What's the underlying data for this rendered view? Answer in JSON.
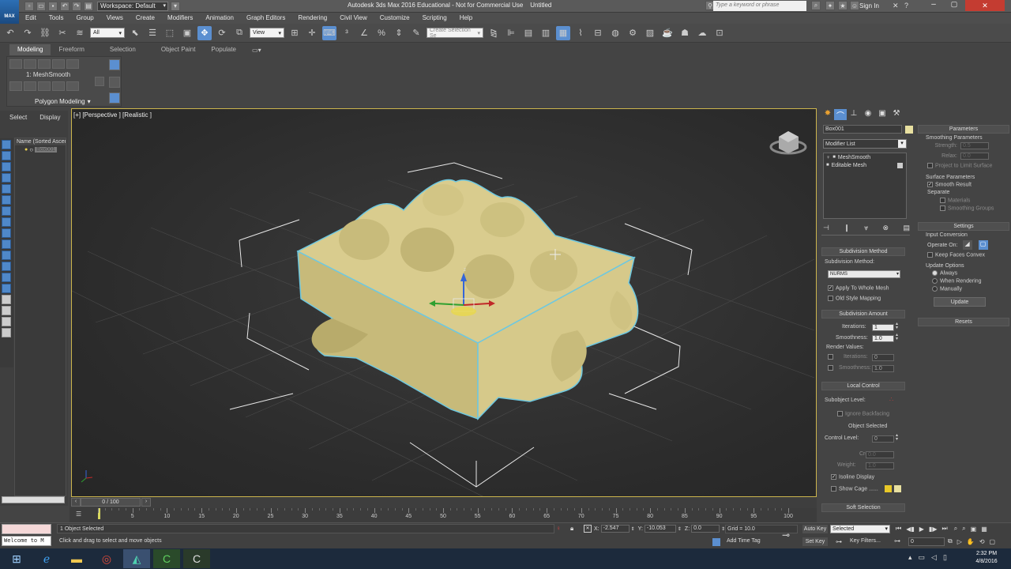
{
  "title_bar": {
    "app_icon_label": "MAX",
    "workspace": "Workspace: Default",
    "title": "Autodesk 3ds Max 2016 Educational - Not for Commercial Use    Untitled",
    "search_placeholder": "Type a keyword or phrase",
    "sign_in": "Sign In"
  },
  "menu": [
    "Edit",
    "Tools",
    "Group",
    "Views",
    "Create",
    "Modifiers",
    "Animation",
    "Graph Editors",
    "Rendering",
    "Civil View",
    "Customize",
    "Scripting",
    "Help"
  ],
  "main_toolbar": {
    "selection_filter": "All",
    "ref_coord": "View",
    "named_selection": "Create Selection Se"
  },
  "ribbon": {
    "tabs": [
      "Modeling",
      "Freeform",
      "Selection",
      "Object Paint",
      "Populate"
    ],
    "modifier_label": "1: MeshSmooth",
    "panel_label": "Polygon Modeling"
  },
  "scene_explorer": {
    "tabs": [
      "Select",
      "Display"
    ],
    "column_header": "Name (Sorted Ascen",
    "object": "Box001"
  },
  "viewport": {
    "label": "[+] [Perspective ] [Realistic ]",
    "gizmo_axis": "z"
  },
  "command_panel": {
    "object_name": "Box001",
    "object_color": "#e8e0a0",
    "modifier_list": "Modifier List",
    "stack": [
      "MeshSmooth",
      "Editable Mesh"
    ],
    "subdivision_method": {
      "header": "Subdivision Method",
      "label": "Subdivision Method:",
      "value": "NURMS",
      "apply_whole": "Apply To Whole Mesh",
      "old_style": "Old Style Mapping"
    },
    "subdivision_amount": {
      "header": "Subdivision Amount",
      "iterations_label": "Iterations:",
      "iterations": "1",
      "smoothness_label": "Smoothness:",
      "smoothness": "1.0",
      "render_values": "Render Values:",
      "r_iterations_label": "Iterations:",
      "r_iterations": "0",
      "r_smoothness_label": "Smoothness:",
      "r_smoothness": "1.0"
    },
    "local_control": {
      "header": "Local Control",
      "subobject": "Subobject Level:",
      "ignore_backfacing": "Ignore Backfacing",
      "object_selected": "Object Selected",
      "control_level_label": "Control Level:",
      "control_level": "0",
      "crease_label": "Crease:",
      "crease": "0.0",
      "weight_label": "Weight:",
      "weight": "1.0",
      "isoline": "Isoline Display",
      "show_cage": "Show Cage ......"
    },
    "soft_selection": "Soft Selection"
  },
  "right_rollout": {
    "parameters": "Parameters",
    "smoothing_params": "Smoothing Parameters",
    "strength_label": "Strength:",
    "strength": "0.5",
    "relax_label": "Relax:",
    "relax": "0.0",
    "project_limit": "Project to Limit Surface",
    "surface_params": "Surface Parameters",
    "smooth_result": "Smooth Result",
    "separate": "Separate",
    "materials": "Materials",
    "smoothing_groups": "Smoothing Groups",
    "settings": "Settings",
    "input_conversion": "Input Conversion",
    "operate_on": "Operate On:",
    "keep_faces_convex": "Keep Faces Convex",
    "update_options": "Update Options",
    "always": "Always",
    "when_rendering": "When Rendering",
    "manually": "Manually",
    "update": "Update",
    "resets": "Resets"
  },
  "timeline": {
    "frame_label": "0 / 100",
    "ticks": [
      "0",
      "5",
      "10",
      "15",
      "20",
      "25",
      "30",
      "35",
      "40",
      "45",
      "50",
      "55",
      "60",
      "65",
      "70",
      "75",
      "80",
      "85",
      "90",
      "95",
      "100"
    ]
  },
  "status": {
    "listener": "Welcome to M",
    "selected": "1 Object Selected",
    "prompt": "Click and drag to select and move objects",
    "x_label": "X:",
    "x": "-2.547",
    "y_label": "Y:",
    "y": "-10.053",
    "z_label": "Z:",
    "z": "0.0",
    "grid": "Grid = 10.0",
    "add_time_tag": "Add Time Tag",
    "auto_key": "Auto Key",
    "set_key": "Set Key",
    "selected_dd": "Selected",
    "key_filters": "Key Filters...",
    "frame": "0"
  },
  "taskbar": {
    "time": "2:32 PM",
    "date": "4/8/2016"
  }
}
